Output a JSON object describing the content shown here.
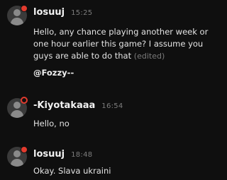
{
  "messages": [
    {
      "author": "losuuj",
      "time": "15:25",
      "text": "Hello, any chance playing another week or one hour earlier this game? I assume you guys are able to do that",
      "edited_label": "(edited)",
      "mention": "@Fozzy--"
    },
    {
      "author": "-Kiyotakaaa",
      "time": "16:54",
      "text": "Hello, no"
    },
    {
      "author": "losuuj",
      "time": "18:48",
      "text": "Okay. Slava ukraini"
    }
  ],
  "colors": {
    "background": "#0f0f0f",
    "badge": "#e23b2e",
    "timestamp": "#7d7d7d"
  }
}
